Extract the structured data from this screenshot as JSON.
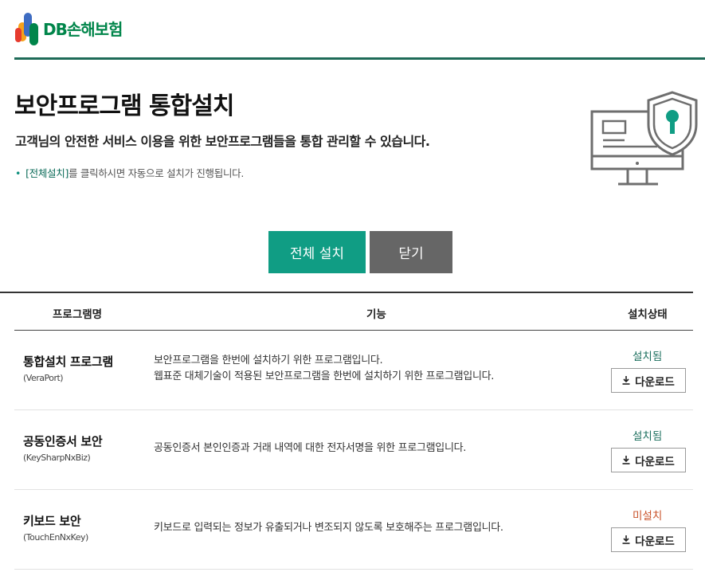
{
  "header": {
    "logo_text": "DB손해보험",
    "colors": {
      "brand_green": "#00854a",
      "rule": "#1e6b58"
    }
  },
  "main": {
    "title": "보안프로그램 통합설치",
    "subtitle": "고객님의 안전한 서비스 이용을 위한 보안프로그램들을 통합 관리할 수 있습니다.",
    "note": {
      "highlight": "[전체설치]",
      "rest": "를 클릭하시면 자동으로 설치가 진행됩니다."
    },
    "illustration_icon": "computer-shield-lock-icon",
    "buttons": {
      "install_all": "전체 설치",
      "close": "닫기"
    },
    "colors": {
      "install": "#109d84",
      "close": "#666666",
      "installed": "#1c6f5e",
      "not_installed": "#c9532a"
    }
  },
  "table": {
    "headers": {
      "name": "프로그램명",
      "function": "기능",
      "status": "설치상태"
    },
    "rows": [
      {
        "name": "통합설치 프로그램",
        "sub": "(VeraPort)",
        "desc": [
          "보안프로그램을 한번에 설치하기 위한 프로그램입니다.",
          "웹표준 대체기술이 적용된 보안프로그램을 한번에 설치하기 위한 프로그램입니다."
        ],
        "status": "설치됨",
        "download": "다운로드"
      },
      {
        "name": "공동인증서 보안",
        "sub": "(KeySharpNxBiz)",
        "desc": [
          "공동인증서 본인인증과 거래 내역에 대한 전자서명을 위한 프로그램입니다."
        ],
        "status": "설치됨",
        "download": "다운로드"
      },
      {
        "name": "키보드 보안",
        "sub": "(TouchEnNxKey)",
        "desc": [
          "키보드로 입력되는 정보가 유출되거나 변조되지 않도록 보호해주는 프로그램입니다."
        ],
        "status": "미설치",
        "download": "다운로드"
      }
    ]
  }
}
